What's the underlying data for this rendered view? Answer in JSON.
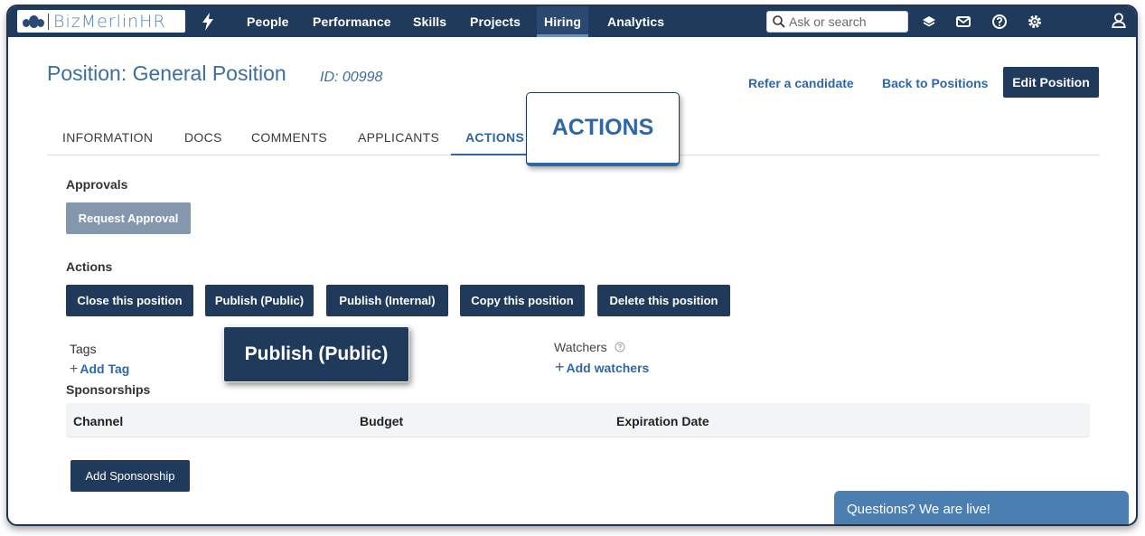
{
  "app": {
    "logo_text": "BizMerlinHR"
  },
  "nav": {
    "items": [
      {
        "label": "People"
      },
      {
        "label": "Performance"
      },
      {
        "label": "Skills"
      },
      {
        "label": "Projects"
      },
      {
        "label": "Hiring",
        "active": true
      },
      {
        "label": "Analytics"
      }
    ],
    "search_placeholder": "Ask or search",
    "icons": [
      "layers-icon",
      "mail-icon",
      "help-icon",
      "settings-icon",
      "user-icon"
    ]
  },
  "header": {
    "title": "Position: General Position",
    "id_label": "ID: 00998",
    "refer_link": "Refer a candidate",
    "back_link": "Back to Positions",
    "edit_button": "Edit Position"
  },
  "tabs": [
    {
      "label": "INFORMATION"
    },
    {
      "label": "DOCS"
    },
    {
      "label": "COMMENTS"
    },
    {
      "label": "APPLICANTS"
    },
    {
      "label": "ACTIONS",
      "active": true
    }
  ],
  "callouts": {
    "tab": "ACTIONS",
    "button": "Publish (Public)"
  },
  "approvals": {
    "heading": "Approvals",
    "button": "Request Approval"
  },
  "actions": {
    "heading": "Actions",
    "buttons": [
      "Close this position",
      "Publish (Public)",
      "Publish (Internal)",
      "Copy this position",
      "Delete this position"
    ]
  },
  "tags": {
    "heading": "Tags",
    "add_link": "Add Tag"
  },
  "watchers": {
    "heading": "Watchers",
    "add_link": "Add watchers"
  },
  "sponsorships": {
    "heading": "Sponsorships",
    "columns": [
      "Channel",
      "Budget",
      "Expiration Date"
    ],
    "add_button": "Add Sponsorship"
  },
  "chat": {
    "label": "Questions? We are live!"
  },
  "colors": {
    "nav_bg": "#203a5c",
    "accent": "#2f67a3",
    "disabled_button": "#8497ad",
    "chat_bg": "#4c7fb1"
  }
}
